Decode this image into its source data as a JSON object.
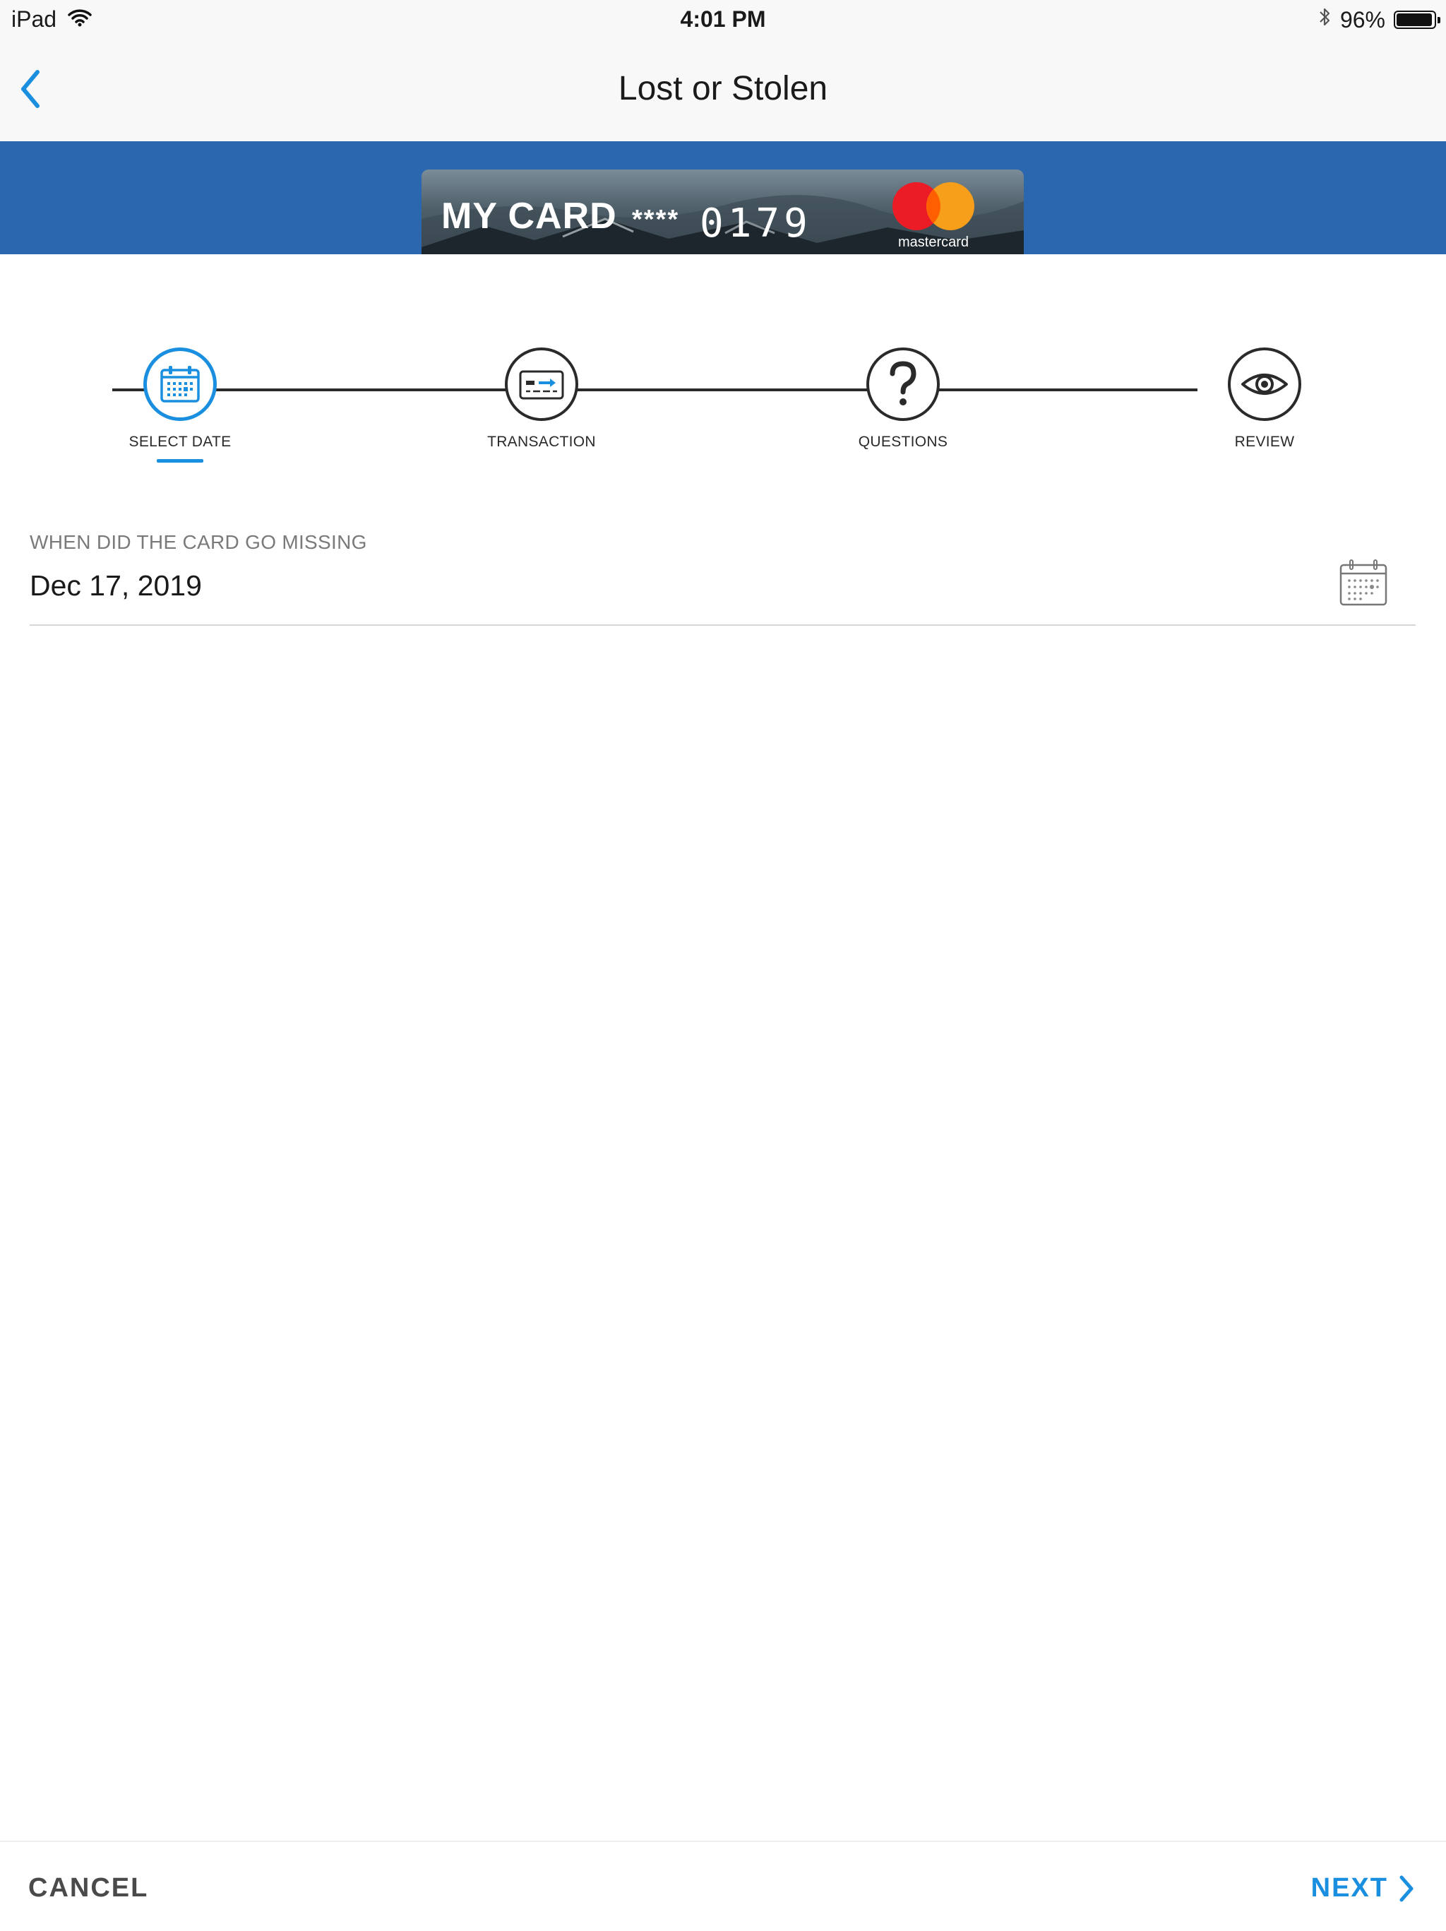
{
  "status_bar": {
    "device": "iPad",
    "time": "4:01 PM",
    "battery": "96%",
    "battery_level": 0.96,
    "icons": [
      "wifi-icon",
      "bluetooth-icon",
      "battery-icon"
    ]
  },
  "nav": {
    "title": "Lost or Stolen",
    "back_icon": "chevron-left-icon"
  },
  "card": {
    "name": "MY CARD",
    "mask": "****",
    "last4": "0179",
    "network": "mastercard",
    "banner_color": "#2b67af"
  },
  "stepper": {
    "steps": [
      {
        "label": "SELECT DATE",
        "icon": "calendar-icon",
        "active": true
      },
      {
        "label": "TRANSACTION",
        "icon": "card-transfer-icon",
        "active": false
      },
      {
        "label": "QUESTIONS",
        "icon": "question-icon",
        "active": false
      },
      {
        "label": "REVIEW",
        "icon": "eye-icon",
        "active": false
      }
    ],
    "accent_color": "#1a8fe0"
  },
  "date_field": {
    "label": "WHEN DID THE CARD GO MISSING",
    "value": "Dec 17, 2019",
    "icon": "calendar-icon"
  },
  "footer": {
    "cancel_label": "CANCEL",
    "next_label": "NEXT",
    "next_icon": "chevron-right-icon"
  }
}
